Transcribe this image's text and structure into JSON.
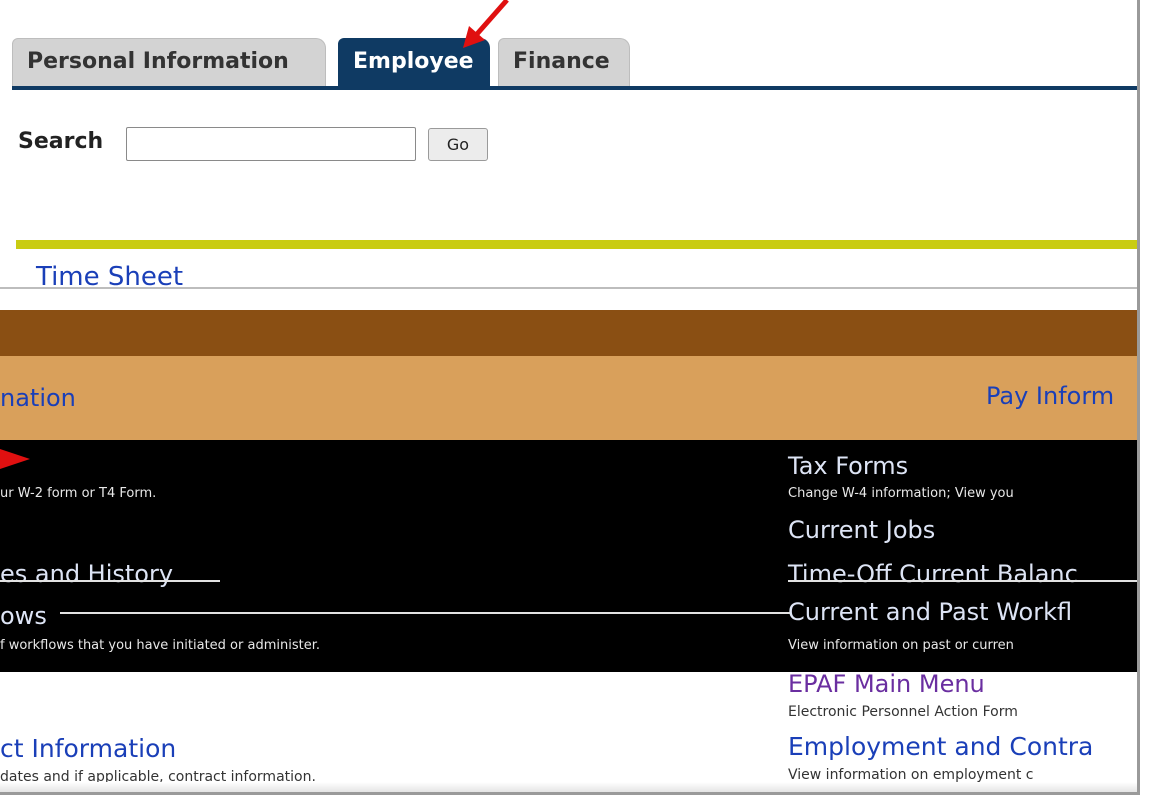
{
  "tabs": [
    {
      "label": "Personal Information",
      "active": false
    },
    {
      "label": "Employee",
      "active": true
    },
    {
      "label": "Finance",
      "active": false
    }
  ],
  "search": {
    "label": "Search",
    "value": "",
    "go_label": "Go"
  },
  "menu": {
    "time_sheet": "Time Sheet",
    "left_col": {
      "pay_info_partial": "nation",
      "tax_desc_partial": "ur W-2 form or T4 Form.",
      "leave_partial": "es and History",
      "workflows_partial": "ows",
      "workflows_desc_partial": "f workflows that you have initiated or administer.",
      "contract_partial": "ct Information",
      "contract_desc_partial": "dates and if applicable, contract information."
    },
    "right_col": {
      "pay_info": "Pay Inform",
      "tax_forms": "Tax Forms",
      "tax_forms_desc": "Change W-4 information; View you",
      "current_jobs": "Current Jobs",
      "time_off": "Time-Off Current Balanc",
      "workflows": "Current and Past Workfl",
      "workflows_desc": "View information on past or curren",
      "epaf": "EPAF Main Menu",
      "epaf_desc": "Electronic Personnel Action Form",
      "employment": "Employment and Contra",
      "employment_desc": "View information on employment c"
    }
  },
  "colors": {
    "tab_active": "#0f3a63",
    "accent_rule": "#c9cc12",
    "link": "#1a3fb8",
    "annotation_arrow": "#e01010"
  }
}
